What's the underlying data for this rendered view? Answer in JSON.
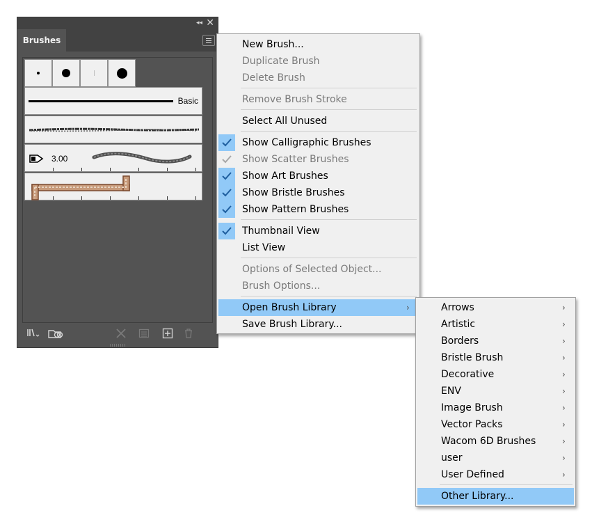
{
  "panel": {
    "tab_label": "Brushes",
    "collapse_glyph": "◂◂",
    "close_glyph": "✕",
    "basic_brush_label": "Basic",
    "art_brush_size": "3.00",
    "bottom_icons": [
      "brush-libraries-menu-icon",
      "libraries-panel-icon",
      "remove-brush-stroke-icon",
      "options-of-selected-object-icon",
      "new-brush-icon",
      "delete-brush-icon"
    ]
  },
  "main_menu": {
    "items": [
      {
        "label": "New Brush...",
        "enabled": true
      },
      {
        "label": "Duplicate Brush",
        "enabled": false
      },
      {
        "label": "Delete Brush",
        "enabled": false
      },
      {
        "label": "Remove Brush Stroke",
        "enabled": false
      },
      {
        "label": "Select All Unused",
        "enabled": true
      },
      {
        "label": "Show Calligraphic Brushes",
        "enabled": true,
        "checked": true
      },
      {
        "label": "Show Scatter Brushes",
        "enabled": false,
        "checked": true
      },
      {
        "label": "Show Art Brushes",
        "enabled": true,
        "checked": true
      },
      {
        "label": "Show Bristle Brushes",
        "enabled": true,
        "checked": true
      },
      {
        "label": "Show Pattern Brushes",
        "enabled": true,
        "checked": true
      },
      {
        "label": "Thumbnail View",
        "enabled": true,
        "checked": true
      },
      {
        "label": "List View",
        "enabled": true
      },
      {
        "label": "Options of Selected Object...",
        "enabled": false
      },
      {
        "label": "Brush Options...",
        "enabled": false
      },
      {
        "label": "Open Brush Library",
        "enabled": true,
        "highlighted": true,
        "submenu": true
      },
      {
        "label": "Save Brush Library...",
        "enabled": true
      }
    ]
  },
  "library_submenu": {
    "items": [
      {
        "label": "Arrows",
        "submenu": true
      },
      {
        "label": "Artistic",
        "submenu": true
      },
      {
        "label": "Borders",
        "submenu": true
      },
      {
        "label": "Bristle Brush",
        "submenu": true
      },
      {
        "label": "Decorative",
        "submenu": true
      },
      {
        "label": "ENV",
        "submenu": true
      },
      {
        "label": "Image Brush",
        "submenu": true
      },
      {
        "label": "Vector Packs",
        "submenu": true
      },
      {
        "label": "Wacom 6D Brushes",
        "submenu": true
      },
      {
        "label": "user",
        "submenu": true
      },
      {
        "label": "User Defined",
        "submenu": true
      },
      {
        "label": "Other Library...",
        "highlighted": true
      }
    ]
  },
  "colors": {
    "panel_bg": "#535353",
    "menu_bg": "#f0f0f0",
    "highlight": "#91c9f7",
    "disabled_text": "#7a7a7a",
    "check": "#1f5f9f"
  }
}
